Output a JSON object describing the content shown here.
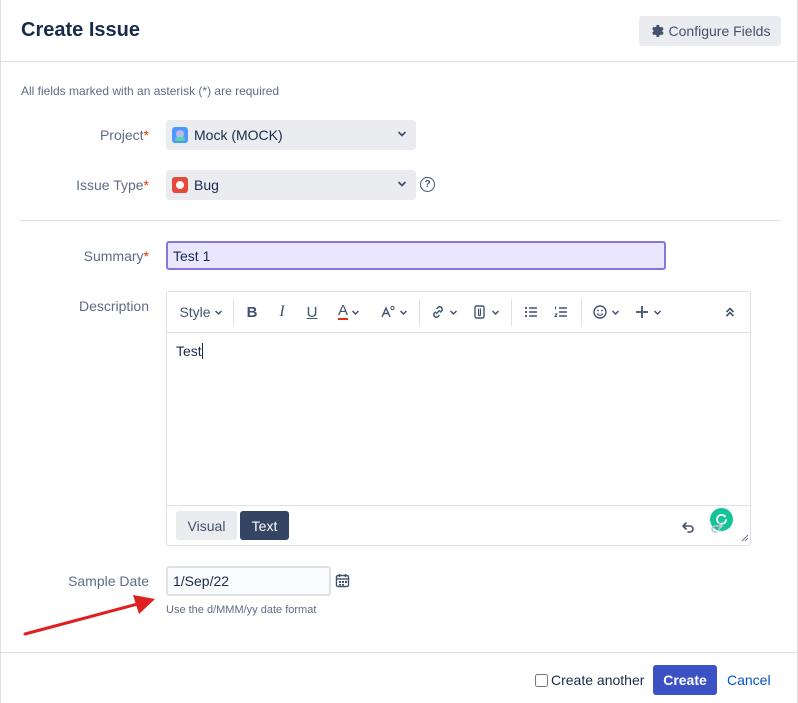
{
  "dialog": {
    "title": "Create Issue",
    "configure_fields_label": "Configure Fields",
    "required_note": "All fields marked with an asterisk (*) are required"
  },
  "project": {
    "label": "Project",
    "value": "Mock (MOCK)"
  },
  "issue_type": {
    "label": "Issue Type",
    "value": "Bug"
  },
  "summary": {
    "label": "Summary",
    "value": "Test 1"
  },
  "description": {
    "label": "Description",
    "content": "Test",
    "toolbar": {
      "style_label": "Style"
    },
    "modes": {
      "visual_label": "Visual",
      "text_label": "Text",
      "active": "Text"
    }
  },
  "sample_date": {
    "label": "Sample Date",
    "value": "1/Sep/22",
    "hint": "Use the d/MMM/yy date format"
  },
  "footer": {
    "create_another_label": "Create another",
    "create_another_checked": false,
    "create_label": "Create",
    "cancel_label": "Cancel"
  },
  "colors": {
    "primary": "#3b51c4",
    "required_asterisk": "#de350b",
    "summary_focus_border": "#8777d9",
    "bug_icon": "#e5493a",
    "annotation_arrow": "#e02020"
  }
}
